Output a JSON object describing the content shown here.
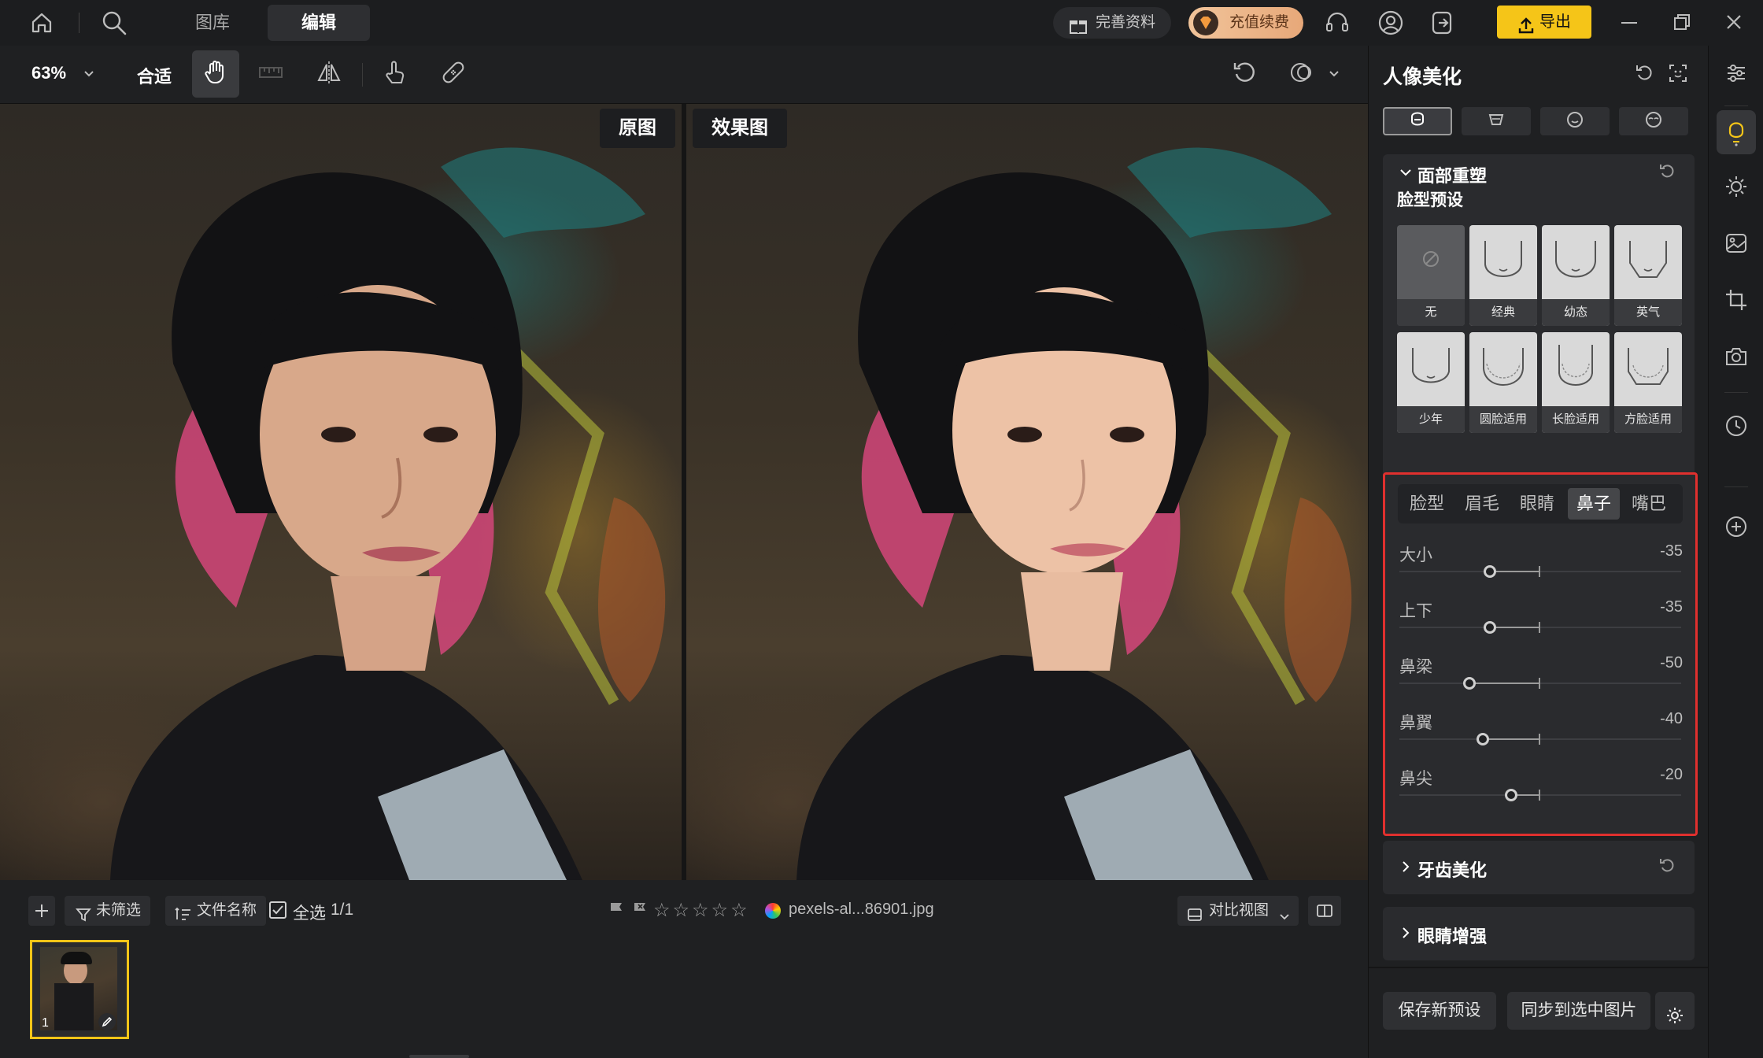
{
  "titlebar": {
    "tabs": [
      {
        "label": "图库"
      },
      {
        "label": "编辑"
      }
    ],
    "profile_btn": "完善资料",
    "recharge_btn": "充值续费",
    "export_btn": "导出"
  },
  "toolbar": {
    "zoom": "63%",
    "fit": "合适"
  },
  "canvas": {
    "original_label": "原图",
    "effect_label": "效果图"
  },
  "bottombar": {
    "unfiltered": "未筛选",
    "filename_sort": "文件名称",
    "select_all": "全选",
    "count": "1/1",
    "filename": "pexels-al...86901.jpg",
    "compare_view": "对比视图",
    "thumb_index": "1"
  },
  "panel": {
    "title": "人像美化",
    "face_reshape": {
      "title": "面部重塑",
      "preset_heading": "脸型预设",
      "presets": [
        {
          "label": "无"
        },
        {
          "label": "经典"
        },
        {
          "label": "幼态"
        },
        {
          "label": "英气"
        },
        {
          "label": "少年"
        },
        {
          "label": "圆脸适用"
        },
        {
          "label": "长脸适用"
        },
        {
          "label": "方脸适用"
        }
      ],
      "feature_tabs": [
        {
          "label": "脸型"
        },
        {
          "label": "眉毛"
        },
        {
          "label": "眼睛"
        },
        {
          "label": "鼻子"
        },
        {
          "label": "嘴巴"
        }
      ],
      "active_tab": "鼻子",
      "sliders": [
        {
          "name": "大小",
          "value": -35
        },
        {
          "name": "上下",
          "value": -35
        },
        {
          "name": "鼻梁",
          "value": -50
        },
        {
          "name": "鼻翼",
          "value": -40
        },
        {
          "name": "鼻尖",
          "value": -20
        }
      ]
    },
    "teeth": {
      "title": "牙齿美化"
    },
    "eyes": {
      "title": "眼睛增强"
    },
    "save_preset": "保存新预设",
    "sync_selected": "同步到选中图片"
  },
  "colors": {
    "accent_yellow": "#f5c518",
    "highlight_red": "#e0302e",
    "bg_dark": "#1f2022"
  }
}
